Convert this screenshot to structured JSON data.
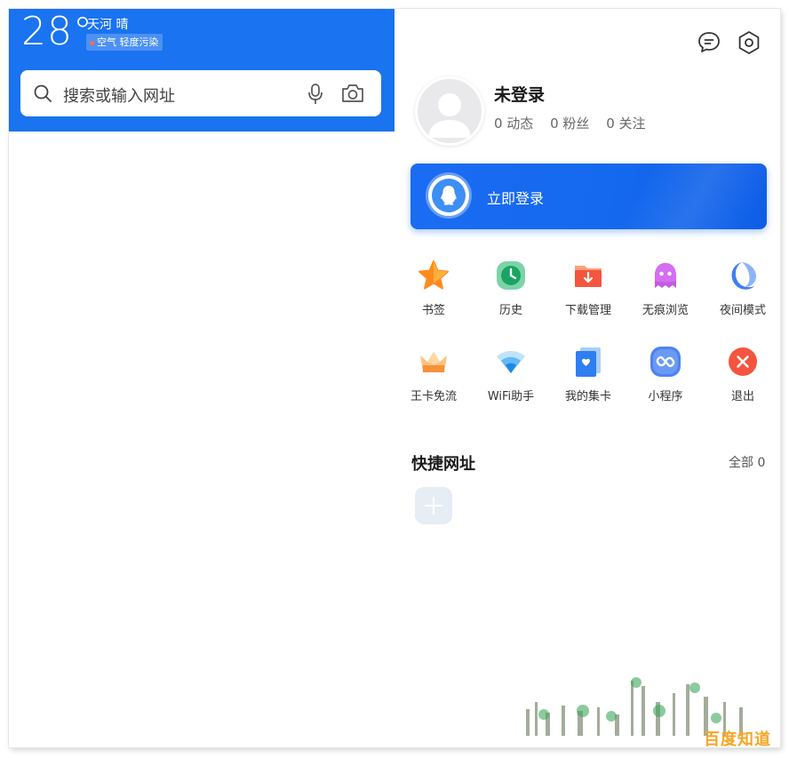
{
  "weather": {
    "temperature": "28°",
    "location": "天河 晴",
    "air_quality": "空气 轻度污染"
  },
  "search": {
    "placeholder": "搜索或输入网址"
  },
  "icons": {
    "search": "search-icon",
    "mic": "mic-icon",
    "camera": "camera-icon",
    "message": "message-icon",
    "settings": "settings-icon",
    "avatar": "avatar-placeholder",
    "qq": "qq-icon"
  },
  "profile": {
    "name": "未登录",
    "stats": [
      "0 动态",
      "0 粉丝",
      "0 关注"
    ]
  },
  "login": {
    "label": "立即登录"
  },
  "grid": [
    {
      "label": "书签",
      "icon": "star-icon"
    },
    {
      "label": "历史",
      "icon": "clock-icon"
    },
    {
      "label": "下载管理",
      "icon": "download-folder-icon"
    },
    {
      "label": "无痕浏览",
      "icon": "ghost-icon"
    },
    {
      "label": "夜间模式",
      "icon": "moon-icon"
    },
    {
      "label": "王卡免流",
      "icon": "crown-icon"
    },
    {
      "label": "WiFi助手",
      "icon": "wifi-icon"
    },
    {
      "label": "我的集卡",
      "icon": "card-icon"
    },
    {
      "label": "小程序",
      "icon": "mini-program-icon"
    },
    {
      "label": "退出",
      "icon": "exit-icon"
    }
  ],
  "shortcuts": {
    "title": "快捷网址",
    "all_label": "全部 0"
  },
  "watermark": "百度知道",
  "colors": {
    "brand_blue": "#1a73f0",
    "login_blue": "#1469ee"
  }
}
